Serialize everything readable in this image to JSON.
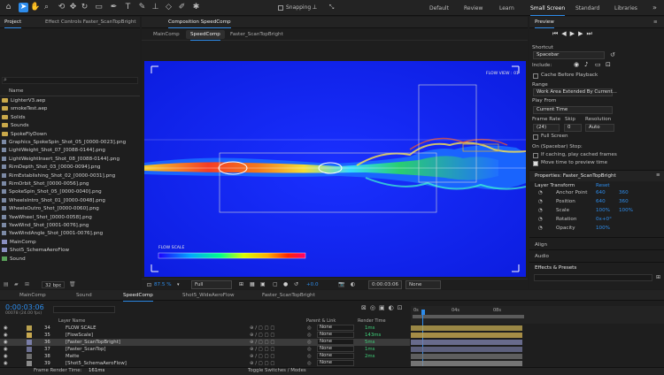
{
  "toolbar": {
    "tools": [
      "home-icon",
      "selection-tool-icon",
      "hand-tool-icon",
      "zoom-tool-icon",
      "orbit-tool-icon",
      "move-tool-icon",
      "rotate-tool-icon",
      "rect-tool-icon",
      "pen-tool-icon",
      "type-tool-icon",
      "brush-tool-icon",
      "stamp-tool-icon",
      "eraser-tool-icon",
      "roto-tool-icon",
      "puppet-tool-icon"
    ],
    "snapping_label": "Snapping",
    "workspaces": [
      "Default",
      "Review",
      "Learn",
      "Small Screen",
      "Standard",
      "Libraries"
    ],
    "active_workspace": "Small Screen"
  },
  "left_panel": {
    "tab_project": "Project",
    "tab_effects": "Effect Controls Faster_ScanTopBright",
    "column_name": "Name",
    "items": [
      {
        "type": "folder",
        "label": "LighterV3.aep"
      },
      {
        "type": "folder",
        "label": "smokeTest.aep"
      },
      {
        "type": "folder",
        "label": "Solids"
      },
      {
        "type": "folder",
        "label": "Sounds"
      },
      {
        "type": "folder",
        "label": "SpokeFlyDown"
      },
      {
        "type": "file",
        "label": "Graphics_SpokeSpin_Shot_05_[0000-0023].png"
      },
      {
        "type": "file",
        "label": "LightWeight_Shot_07_[0088-0144].png"
      },
      {
        "type": "file",
        "label": "LightWeightInsert_Shot_08_[0088-0144].png"
      },
      {
        "type": "file",
        "label": "RimDepth_Shot_03_[0000-0094].png"
      },
      {
        "type": "file",
        "label": "RimEstablishing_Shot_02_[0000-0031].png"
      },
      {
        "type": "file",
        "label": "RimOrbit_Shot_[0000-0056].png"
      },
      {
        "type": "file",
        "label": "SpokeSpin_Shot_05_[0000-0040].png"
      },
      {
        "type": "file",
        "label": "WheelsIntro_Shot_01_[0000-0048].png"
      },
      {
        "type": "file",
        "label": "WheelsOutro_Shot_[0000-0060].png"
      },
      {
        "type": "file",
        "label": "YawWheel_Shot_[0000-0058].png"
      },
      {
        "type": "file",
        "label": "YawWind_Shot_[0001-0076].png"
      },
      {
        "type": "file",
        "label": "YawWindAngle_Shot_[0001-0076].png"
      },
      {
        "type": "comp",
        "label": "MainComp"
      },
      {
        "type": "comp",
        "label": "Shot5_SchemaAeroFlow"
      },
      {
        "type": "audio",
        "label": "Sound"
      }
    ],
    "bpc": "32 bpc"
  },
  "viewer": {
    "panel_title": "Composition SpeedComp",
    "tabs": [
      "MainComp",
      "SpeedComp",
      "Faster_ScanTopBright"
    ],
    "active_tab": "SpeedComp",
    "flow_view_label": "FLOW VIEW : 01",
    "flow_scale_label": "FLOW SCALE",
    "zoom": "87.5 %",
    "resolution": "Full",
    "exposure": "+0.0",
    "timecode": "0:00:03:06",
    "view_option": "None"
  },
  "preview": {
    "title": "Preview",
    "shortcut_label": "Shortcut",
    "shortcut_value": "Spacebar",
    "include_label": "Include:",
    "cache_before_label": "Cache Before Playback",
    "range_label": "Range",
    "range_value": "Work Area Extended By Current...",
    "play_from_label": "Play From",
    "play_from_value": "Current Time",
    "frame_rate_label": "Frame Rate",
    "frame_rate_value": "(24)",
    "skip_label": "Skip",
    "skip_value": "0",
    "resolution_label": "Resolution",
    "resolution_value": "Auto",
    "full_screen_label": "Full Screen",
    "on_stop_label": "On (Spacebar) Stop:",
    "if_caching_label": "If caching, play cached frames",
    "move_time_label": "Move time to preview time"
  },
  "properties": {
    "title": "Properties: Faster_ScanTopBright",
    "layer_transform": "Layer Transform",
    "reset": "Reset",
    "rows": [
      {
        "label": "Anchor Point",
        "v1": "640",
        "v2": "360"
      },
      {
        "label": "Position",
        "v1": "640",
        "v2": "360"
      },
      {
        "label": "Scale",
        "v1": "100%",
        "v2": "100%"
      },
      {
        "label": "Rotation",
        "v1": "0x+0°",
        "v2": ""
      },
      {
        "label": "Opacity",
        "v1": "100%",
        "v2": ""
      }
    ],
    "align": "Align",
    "audio": "Audio",
    "effects_presets": "Effects & Presets"
  },
  "timeline": {
    "tabs": [
      "MainComp",
      "Sound",
      "SpeedComp",
      "Shot5_WideAeroFlow",
      "Faster_ScanTopBright"
    ],
    "active_tab": "SpeedComp",
    "timecode": "0:00:03:06",
    "frame_info": "00078 (24.00 fps)",
    "col_layer_name": "Layer Name",
    "col_parent": "Parent & Link",
    "col_render": "Render Time",
    "layers": [
      {
        "num": "34",
        "name": "FLOW SCALE",
        "parent": "None",
        "render": "1ms",
        "bar": "#b9a14f"
      },
      {
        "num": "35",
        "name": "[FlowScale]",
        "parent": "None",
        "render": "143ms",
        "bar": "#c8a950"
      },
      {
        "num": "36",
        "name": "[Faster_ScanTopBright]",
        "parent": "None",
        "render": "5ms",
        "bar": "#7a7ea8",
        "selected": true
      },
      {
        "num": "37",
        "name": "[Faster_ScanTop]",
        "parent": "None",
        "render": "1ms",
        "bar": "#6b6f92"
      },
      {
        "num": "38",
        "name": "Matte",
        "parent": "None",
        "render": "2ms",
        "bar": "#6e6e6e"
      },
      {
        "num": "39",
        "name": "[Shot5_SchemaAeroFlow]",
        "parent": "None",
        "render": "",
        "bar": "#8b8b8b"
      }
    ],
    "ruler": [
      "0s",
      "04s",
      "08s"
    ],
    "footer_render_label": "Frame Render Time:",
    "footer_render_value": "161ms",
    "footer_toggle": "Toggle Switches / Modes"
  }
}
